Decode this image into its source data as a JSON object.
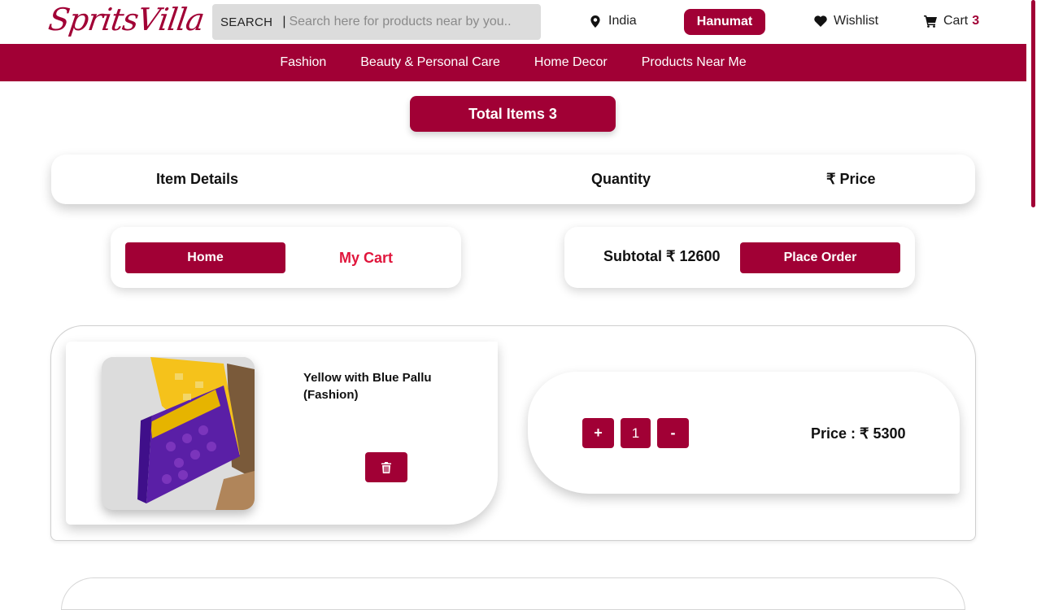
{
  "header": {
    "logo": "SpritsVilla",
    "search_label": "SEARCH",
    "search_separator": "|",
    "search_placeholder": "Search here for products near by you..",
    "location": "India",
    "user_name": "Hanumat",
    "wishlist_label": "Wishlist",
    "cart_label": "Cart",
    "cart_count": "3"
  },
  "nav": {
    "items": [
      "Fashion",
      "Beauty & Personal Care",
      "Home Decor",
      "Products Near Me"
    ]
  },
  "cart": {
    "total_items": "Total Items 3",
    "columns": {
      "details": "Item Details",
      "quantity": "Quantity",
      "price": "₹ Price"
    },
    "home_button": "Home",
    "my_cart_label": "My Cart",
    "subtotal": "Subtotal ₹ 12600",
    "place_order_button": "Place Order",
    "items": [
      {
        "name": "Yellow with Blue Pallu (Fashion)",
        "plus_label": "+",
        "quantity": "1",
        "minus_label": "-",
        "price": "Price : ₹ 5300"
      }
    ]
  },
  "colors": {
    "brand": "#a10035",
    "my_cart_text": "#e0163c"
  },
  "icons": [
    "map-pin-icon",
    "heart-icon",
    "shopping-cart-icon",
    "trash-icon"
  ]
}
